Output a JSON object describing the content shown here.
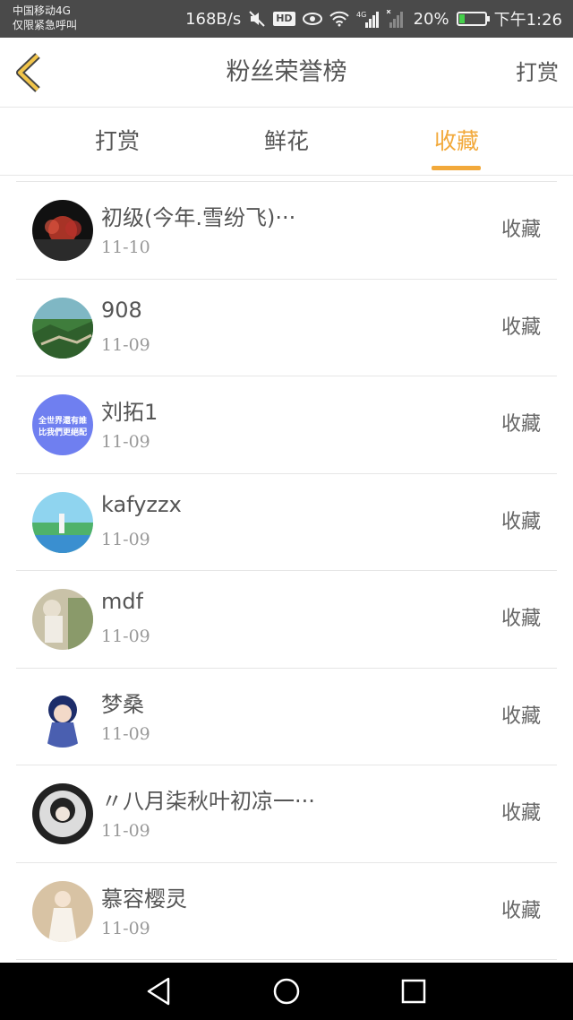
{
  "status_bar": {
    "carrier": "中国移动4G",
    "emergency": "仅限紧急呼叫",
    "speed": "168B/s",
    "hd_badge": "HD",
    "signal_label": "4G",
    "battery_percent": "20%",
    "battery_level": 0.2,
    "time": "下午1:26"
  },
  "header": {
    "back_icon": "chevron-left-icon",
    "title": "粉丝荣誉榜",
    "action": "打赏"
  },
  "tabs": [
    {
      "label": "打赏",
      "active": false
    },
    {
      "label": "鲜花",
      "active": false
    },
    {
      "label": "收藏",
      "active": true
    }
  ],
  "accent_color": "#f2a93b",
  "list": [
    {
      "name": "初级(今年.雪纷飞)···",
      "date": "11-10",
      "action": "收藏"
    },
    {
      "name": "908",
      "date": "11-09",
      "action": "收藏"
    },
    {
      "name": "刘拓1",
      "date": "11-09",
      "action": "收藏",
      "avatar_text": [
        "全世界還有誰",
        "比我們更絕配"
      ]
    },
    {
      "name": "kafyzzx",
      "date": "11-09",
      "action": "收藏"
    },
    {
      "name": "mdf",
      "date": "11-09",
      "action": "收藏"
    },
    {
      "name": "梦桑",
      "date": "11-09",
      "action": "收藏"
    },
    {
      "name": "〃八月柒秋叶初凉一···",
      "date": "11-09",
      "action": "收藏"
    },
    {
      "name": "慕容樱灵",
      "date": "11-09",
      "action": "收藏"
    }
  ],
  "nav_bar": {
    "icons": [
      "back-triangle-icon",
      "home-circle-icon",
      "recents-square-icon"
    ]
  }
}
